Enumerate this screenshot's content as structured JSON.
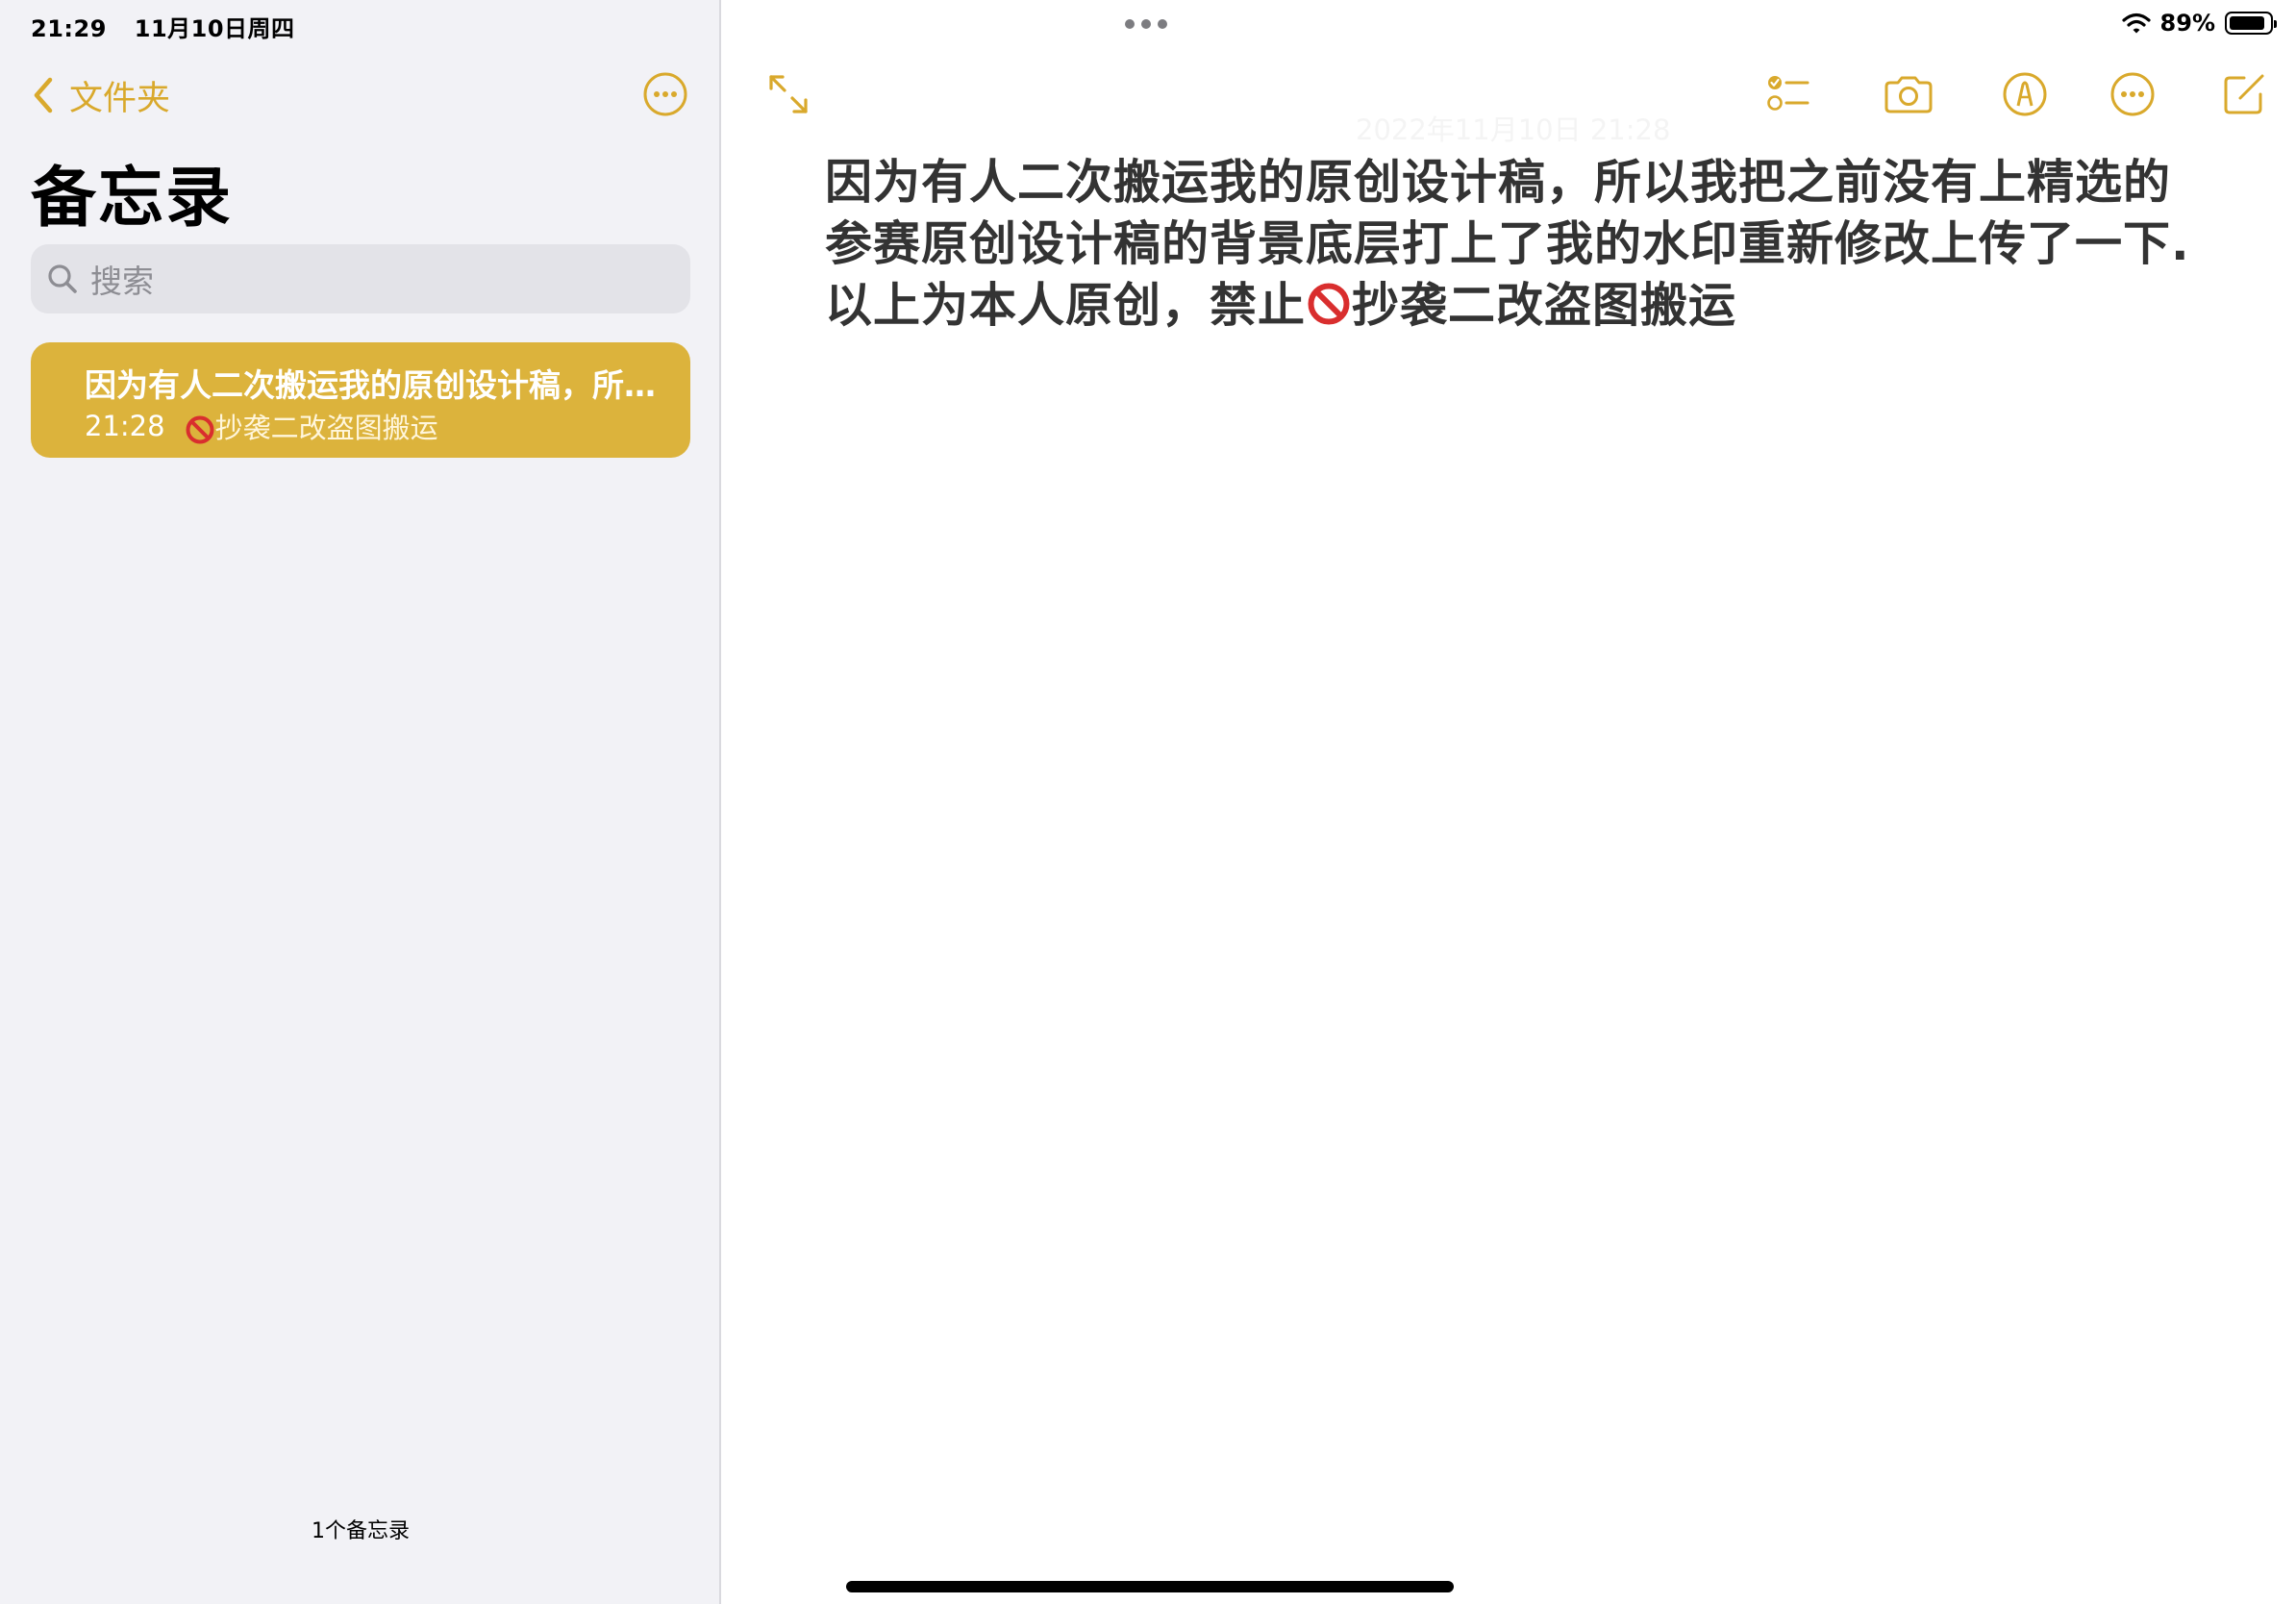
{
  "status_bar": {
    "time": "21:29",
    "date": "11月10日周四",
    "battery_percent": "89%",
    "battery_level": 0.89
  },
  "sidebar": {
    "back_label": "文件夹",
    "title": "备忘录",
    "search_placeholder": "搜索",
    "notes": [
      {
        "title": "因为有人二次搬运我的原创设计稿，所以我把之前没有上精选的参赛原创设计稿的背景底层打上了我的水印重新修改上传了一下.以上为本人原创，禁止🚫抄袭二改盗图搬运",
        "time": "21:28",
        "preview": "抄袭二改盗图搬运"
      }
    ],
    "note_count": "1个备忘录"
  },
  "editor": {
    "date_header": "2022年11月10日 21:28",
    "body_part1": "因为有人二次搬运我的原创设计稿，所以我把之前没有上精选的参赛原创设计稿的背景底层打上了我的水印重新修改上传了一下.以上为本人原创，禁止",
    "body_part2": "抄袭二改盗图搬运"
  },
  "colors": {
    "accent": "#d9a92c",
    "selected_note": "#dcb33c",
    "sidebar_bg": "#f2f2f6"
  },
  "icons": [
    "chevron-left-icon",
    "more-icon",
    "search-icon",
    "expand-icon",
    "checklist-icon",
    "camera-icon",
    "markup-icon",
    "compose-icon",
    "prohibited-icon",
    "wifi-icon",
    "battery-icon"
  ]
}
